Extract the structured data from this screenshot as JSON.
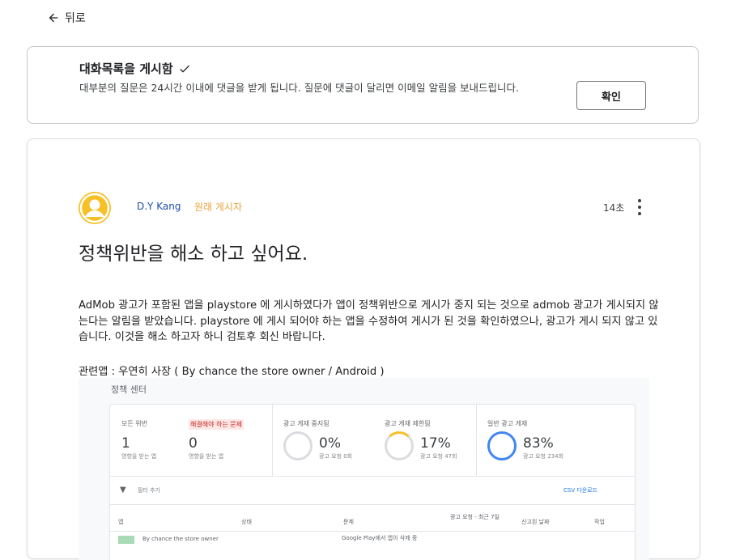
{
  "nav": {
    "back_label": "뒤로"
  },
  "banner": {
    "title": "대화목록을 게시함",
    "text": "대부분의 질문은 24시간 이내에 댓글을 받게 됩니다. 질문에 댓글이 달리면 이메일 알림을 보내드립니다.",
    "confirm_label": "확인"
  },
  "post": {
    "author": "D.Y Kang",
    "op_badge": "원래 게시자",
    "time": "14초",
    "title": "정책위반을 해소 하고 싶어요.",
    "body": "AdMob 광고가 포함된 앱을 playstore 에 게시하였다가 앱이 정책위반으로 게시가 중지 되는 것으로 admob 광고가 게시되지 않는다는 알림을 받았습니다. playstore 에 게시 되어야 하는 앱을 수정하여 게시가 된 것을 확인하였으나, 광고가 게시 되지 않고 있습니다. 이것을 해소 하고자 하니 검토후 회신 바랍니다.",
    "related": "관련앱 : 우연히 사장 ( By chance the store owner / Android )"
  },
  "screenshot": {
    "page_title": "정책 센터",
    "metrics": [
      {
        "label": "모든 위반",
        "value": "1",
        "sub": "영향을 받는 앱"
      },
      {
        "label": "해결해야 하는 문제",
        "value": "0",
        "sub": "영향을 받는 앱"
      },
      {
        "label": "광고 게재 중지됨",
        "value": "0%",
        "sub": "광고 요청 0회"
      },
      {
        "label": "광고 게재 제한됨",
        "value": "17%",
        "sub": "광고 요청 47회"
      },
      {
        "label": "일반 광고 게재",
        "value": "83%",
        "sub": "광고 요청 234회"
      }
    ],
    "filter_label": "필터 추가",
    "csv_label": "CSV 다운로드",
    "columns": [
      "앱",
      "상태",
      "문제",
      "광고 요청 - 최근 7일",
      "신고된 날짜",
      "작업"
    ],
    "row": {
      "app": "By chance the store owner",
      "issue": "Google Play에서 앱이 삭제 중"
    },
    "colors": {
      "blue": "#4285f4",
      "amber": "#f6c026",
      "red_chip_bg": "#fce8e6"
    }
  }
}
